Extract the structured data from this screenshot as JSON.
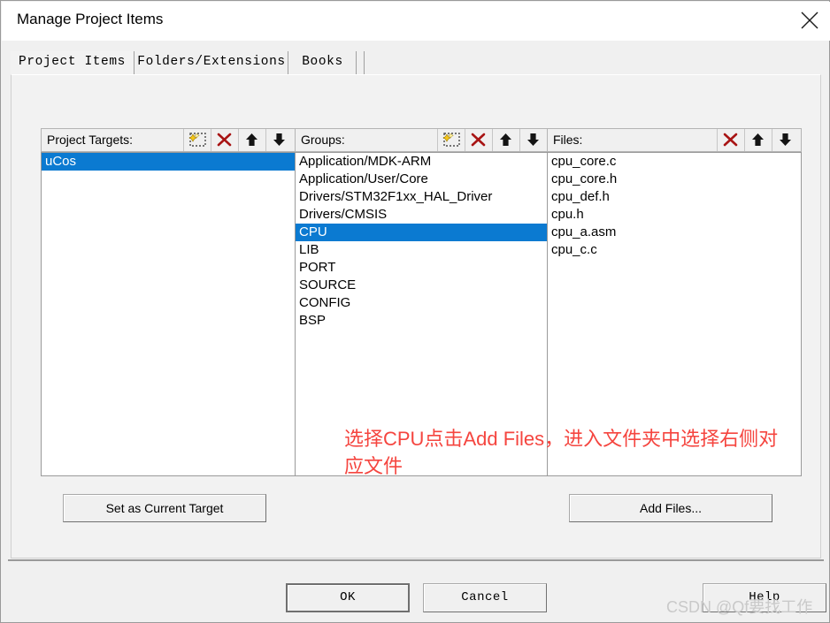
{
  "window": {
    "title": "Manage Project Items",
    "close_icon": "close-icon"
  },
  "tabs": [
    {
      "label": "Project Items",
      "active": true
    },
    {
      "label": "Folders/Extensions",
      "active": false
    },
    {
      "label": "Books",
      "active": false
    },
    {
      "label": "",
      "active": false
    }
  ],
  "columns": {
    "targets": {
      "header_label": "Project Targets:",
      "buttons": [
        {
          "name": "new-item-icon",
          "title": "New (Insert)"
        },
        {
          "name": "delete-icon",
          "title": "Remove"
        },
        {
          "name": "arrow-up-icon",
          "title": "Move Up"
        },
        {
          "name": "arrow-down-icon",
          "title": "Move Down"
        }
      ],
      "items": [
        {
          "label": "uCos",
          "selected": true
        }
      ]
    },
    "groups": {
      "header_label": "Groups:",
      "buttons": [
        {
          "name": "new-item-icon",
          "title": "New (Insert)"
        },
        {
          "name": "delete-icon",
          "title": "Remove"
        },
        {
          "name": "arrow-up-icon",
          "title": "Move Up"
        },
        {
          "name": "arrow-down-icon",
          "title": "Move Down"
        }
      ],
      "items": [
        {
          "label": "Application/MDK-ARM",
          "selected": false
        },
        {
          "label": "Application/User/Core",
          "selected": false
        },
        {
          "label": "Drivers/STM32F1xx_HAL_Driver",
          "selected": false
        },
        {
          "label": "Drivers/CMSIS",
          "selected": false
        },
        {
          "label": "CPU",
          "selected": true
        },
        {
          "label": "LIB",
          "selected": false
        },
        {
          "label": "PORT",
          "selected": false
        },
        {
          "label": "SOURCE",
          "selected": false
        },
        {
          "label": "CONFIG",
          "selected": false
        },
        {
          "label": "BSP",
          "selected": false
        }
      ]
    },
    "files": {
      "header_label": "Files:",
      "buttons": [
        {
          "name": "delete-icon",
          "title": "Remove"
        },
        {
          "name": "arrow-up-icon",
          "title": "Move Up"
        },
        {
          "name": "arrow-down-icon",
          "title": "Move Down"
        }
      ],
      "items": [
        {
          "label": "cpu_core.c",
          "selected": false
        },
        {
          "label": "cpu_core.h",
          "selected": false
        },
        {
          "label": "cpu_def.h",
          "selected": false
        },
        {
          "label": "cpu.h",
          "selected": false
        },
        {
          "label": "cpu_a.asm",
          "selected": false
        },
        {
          "label": "cpu_c.c",
          "selected": false
        }
      ]
    }
  },
  "buttons": {
    "set_as_current_target": "Set as Current Target",
    "add_files": "Add Files...",
    "ok": "OK",
    "cancel": "Cancel",
    "help": "Help"
  },
  "annotation": {
    "line1": "选择CPU点击Add Files，进入文件夹中选择右侧对",
    "line2": "应文件",
    "color": "#f5453f"
  },
  "watermark": {
    "text": "CSDN @Qf要找工作",
    "color": "#c9c9c9"
  },
  "colors": {
    "selection_blue": "#0b7ad1",
    "dialog_bg": "#f0f0f0",
    "panel_bg": "#f2f2f2",
    "listbox_bg": "#ffffff",
    "delete_red": "#aa1111"
  }
}
